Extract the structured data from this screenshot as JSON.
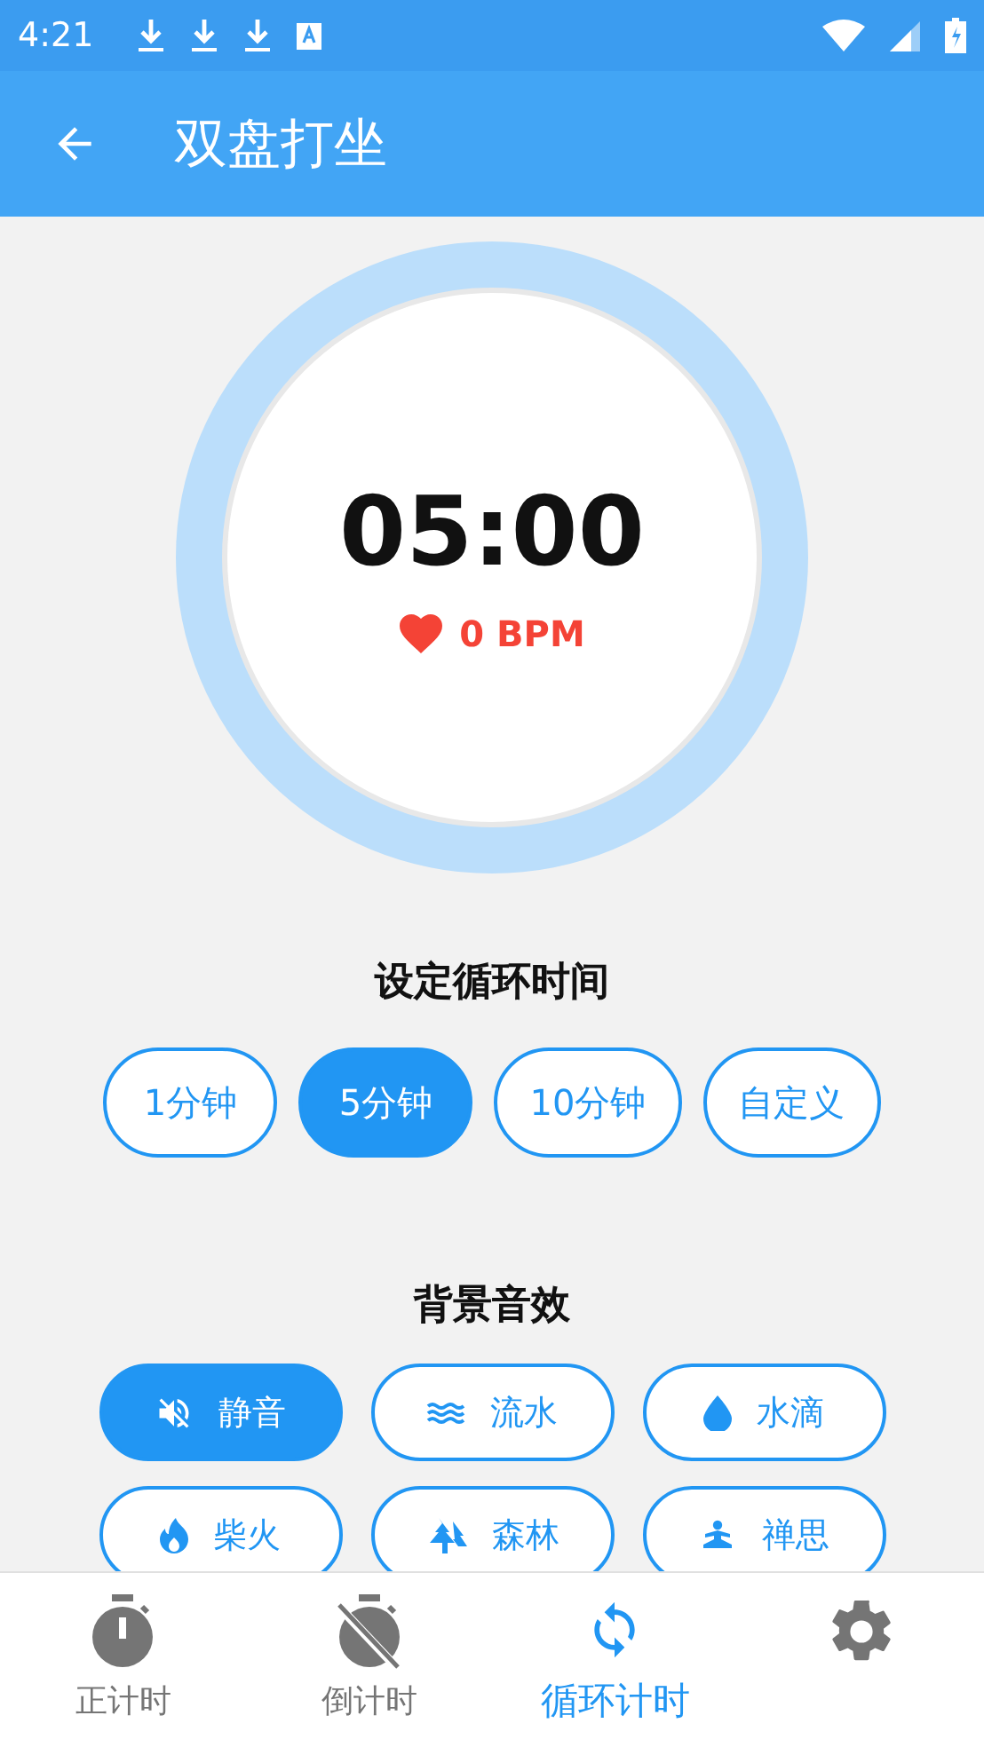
{
  "status_bar": {
    "time": "4:21"
  },
  "app_bar": {
    "title": "双盘打坐"
  },
  "timer": {
    "time": "05:00",
    "bpm": "0 BPM"
  },
  "cycle": {
    "title": "设定循环时间",
    "options": [
      {
        "label": "1分钟",
        "selected": false
      },
      {
        "label": "5分钟",
        "selected": true
      },
      {
        "label": "10分钟",
        "selected": false
      },
      {
        "label": "自定义",
        "selected": false
      }
    ]
  },
  "sounds": {
    "title": "背景音效",
    "options": [
      {
        "kind": "mute",
        "label": "静音",
        "selected": true
      },
      {
        "kind": "water",
        "label": "流水",
        "selected": false
      },
      {
        "kind": "drop",
        "label": "水滴",
        "selected": false
      },
      {
        "kind": "fire",
        "label": "柴火",
        "selected": false
      },
      {
        "kind": "forest",
        "label": "森林",
        "selected": false
      },
      {
        "kind": "zen",
        "label": "禅思",
        "selected": false
      }
    ]
  },
  "nav": [
    {
      "kind": "stopwatch",
      "label": "正计时",
      "selected": false
    },
    {
      "kind": "countdown",
      "label": "倒计时",
      "selected": false
    },
    {
      "kind": "cycle",
      "label": "循环计时",
      "selected": true
    },
    {
      "kind": "settings",
      "selected": false
    }
  ]
}
